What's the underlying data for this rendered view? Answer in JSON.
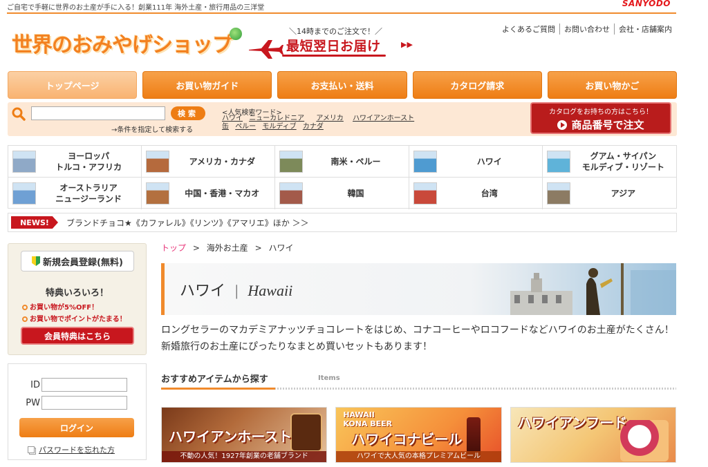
{
  "top": {
    "tagline": "ご自宅で手軽に世界のお土産が手に入る！創業111年 海外土産・旅行用品の三洋堂",
    "brand": "SANYODO"
  },
  "header": {
    "logo": "世界のおみやげショップ",
    "promo_sub": "＼14時までのご注文で！／",
    "promo_main": "最短翌日お届け",
    "util_links": [
      "よくあるご質問",
      "お問い合わせ",
      "会社・店舗案内"
    ]
  },
  "nav": [
    "トップページ",
    "お買い物ガイド",
    "お支払い・送料",
    "カタログ請求",
    "お買い物かご"
  ],
  "search": {
    "button": "検索",
    "advanced": "→条件を指定して検索する",
    "popular_label": "<人気検索ワード>",
    "popular_words": [
      "ハワイ",
      "ニューカレドニア",
      "アメリカ",
      "ハワイアンホースト",
      "缶",
      "ペルー",
      "モルディブ",
      "カナダ"
    ],
    "catalog_small": "カタログをお持ちの方はこちら！",
    "catalog_big": "商品番号で注文"
  },
  "regions": [
    {
      "label": "ヨーロッパ\nトルコ・アフリカ",
      "color": "#8fa9c7"
    },
    {
      "label": "アメリカ・カナダ",
      "color": "#b56a3d"
    },
    {
      "label": "南米・ペルー",
      "color": "#7d8a5a"
    },
    {
      "label": "ハワイ",
      "color": "#4f9bd1"
    },
    {
      "label": "グアム・サイパン\nモルディブ・リゾート",
      "color": "#5fb3d9"
    },
    {
      "label": "オーストラリア\nニュージーランド",
      "color": "#6fa0d4"
    },
    {
      "label": "中国・香港・マカオ",
      "color": "#b3703f"
    },
    {
      "label": "韓国",
      "color": "#a35a4a"
    },
    {
      "label": "台湾",
      "color": "#c9493a"
    },
    {
      "label": "アジア",
      "color": "#8c7b63"
    }
  ],
  "news": {
    "badge": "NEWS!",
    "text": "ブランドチョコ★《カファレル》《リンツ》《アマリエ》ほか ＞＞"
  },
  "member": {
    "register": "新規会員登録(無料)",
    "benefits_title": "特典いろいろ！",
    "benefits": [
      "お買い物が5%OFF！",
      "お買い物でポイントがたまる！"
    ],
    "benefits_button": "会員特典はこちら"
  },
  "login": {
    "id_label": "ID",
    "pw_label": "PW",
    "button": "ログイン",
    "forgot": "パスワードを忘れた方"
  },
  "breadcrumb": {
    "home": "トップ",
    "level1": "海外お土産",
    "current": "ハワイ",
    "sep": ">"
  },
  "hero": {
    "title_jp": "ハワイ",
    "sep": "|",
    "title_en": "Hawaii"
  },
  "intro": "ロングセラーのマカデミアナッツチョコレートをはじめ、コナコーヒーやロコフードなどハワイのお土産がたくさん！新婚旅行のお土産にぴったりなまとめ買いセットもあります！",
  "section": {
    "title": "おすすめアイテムから探す",
    "sub": "Items"
  },
  "cards": [
    {
      "title": "ハワイアンホースト",
      "sub": "不動の人気！1927年創業の老舗ブランド",
      "top": ""
    },
    {
      "title": "ハワイコナビール",
      "sub": "ハワイで大人気の本格プレミアムビール",
      "top": "HAWAII\nKONA BEER"
    },
    {
      "title": "ハワイアンフード",
      "sub": "",
      "top": ""
    }
  ],
  "colors": {
    "accent": "#f08a2c",
    "red": "#c8171e",
    "search_bg": "#fde8d5"
  }
}
